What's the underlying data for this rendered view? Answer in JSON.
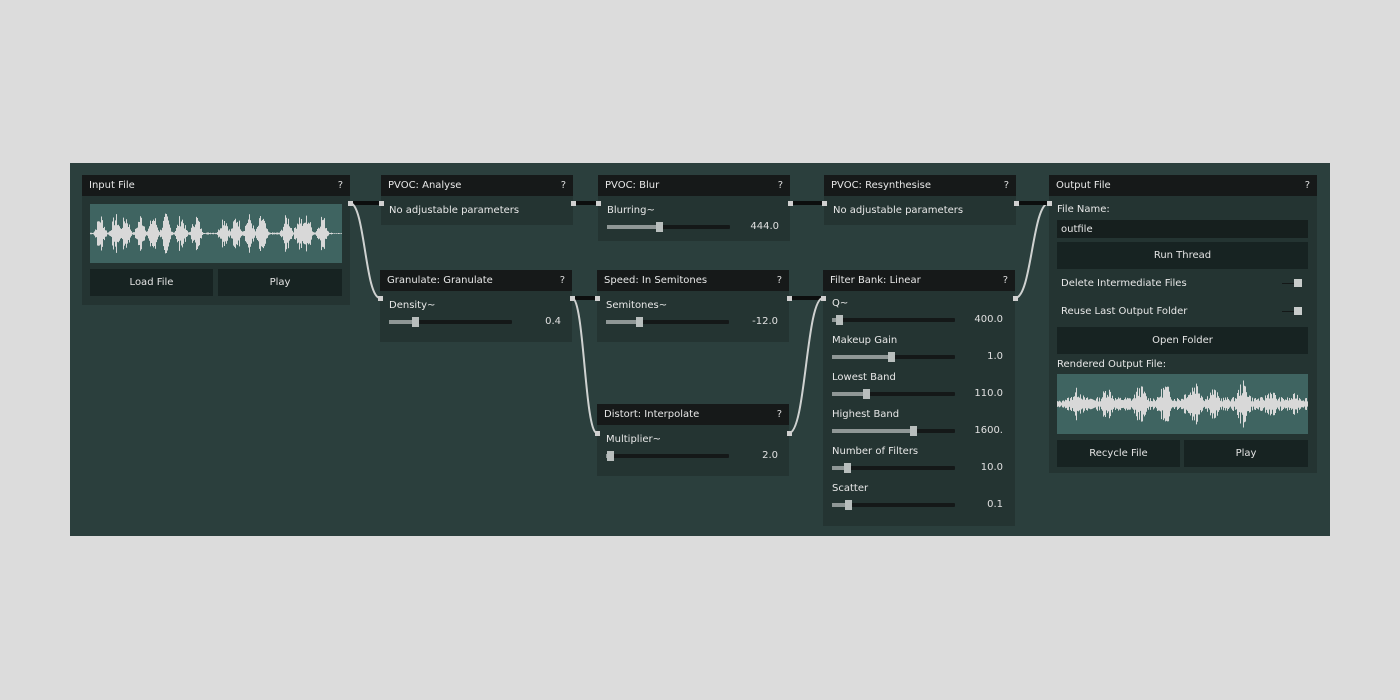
{
  "nodes": {
    "input": {
      "title": "Input File",
      "help": "?",
      "load_label": "Load File",
      "play_label": "Play"
    },
    "analyse": {
      "title": "PVOC: Analyse",
      "help": "?",
      "note": "No adjustable parameters"
    },
    "blur": {
      "title": "PVOC: Blur",
      "help": "?",
      "param": {
        "label": "Blurring~",
        "value": "444.0",
        "level": 0.42
      }
    },
    "resynth": {
      "title": "PVOC: Resynthesise",
      "help": "?",
      "note": "No adjustable parameters"
    },
    "granulate": {
      "title": "Granulate: Granulate",
      "help": "?",
      "param": {
        "label": "Density~",
        "value": "0.4",
        "level": 0.21
      }
    },
    "speed": {
      "title": "Speed: In Semitones",
      "help": "?",
      "param": {
        "label": "Semitones~",
        "value": "-12.0",
        "level": 0.27
      }
    },
    "distort": {
      "title": "Distort: Interpolate",
      "help": "?",
      "param": {
        "label": "Multiplier~",
        "value": "2.0",
        "level": 0.03
      }
    },
    "filterbank": {
      "title": "Filter Bank: Linear",
      "help": "?",
      "params": [
        {
          "label": "Q~",
          "value": "400.0",
          "level": 0.06
        },
        {
          "label": "Makeup Gain",
          "value": "1.0",
          "level": 0.48
        },
        {
          "label": "Lowest Band",
          "value": "110.0",
          "level": 0.28
        },
        {
          "label": "Highest Band",
          "value": "1600.",
          "level": 0.66
        },
        {
          "label": "Number of Filters",
          "value": "10.0",
          "level": 0.12
        },
        {
          "label": "Scatter",
          "value": "0.1",
          "level": 0.13
        }
      ]
    },
    "output": {
      "title": "Output File",
      "help": "?",
      "file_name_label": "File Name:",
      "file_name_value": "outfile",
      "run_label": "Run Thread",
      "delete_label": "Delete Intermediate Files",
      "delete_checked": true,
      "reuse_label": "Reuse Last Output Folder",
      "reuse_checked": true,
      "open_label": "Open Folder",
      "rendered_label": "Rendered Output File:",
      "recycle_label": "Recycle File",
      "play_label": "Play"
    }
  },
  "colors": {
    "canvas": "#2b3f3d",
    "node": "#243432",
    "header": "#161919",
    "waveform_bg": "#3f6461",
    "waveform": "#d8d8d8"
  }
}
